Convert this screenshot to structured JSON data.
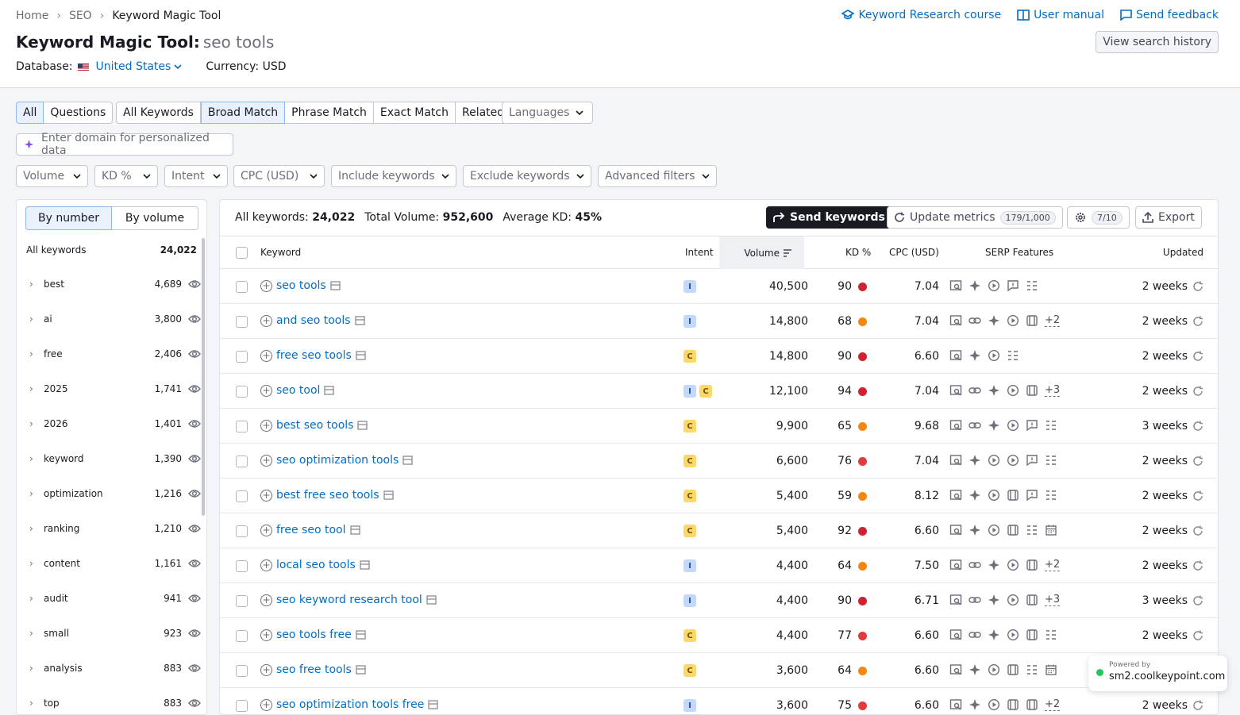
{
  "breadcrumb": [
    "Home",
    "SEO",
    "Keyword Magic Tool"
  ],
  "top_links": {
    "course": "Keyword Research course",
    "manual": "User manual",
    "feedback": "Send feedback"
  },
  "title": {
    "main": "Keyword Magic Tool:",
    "query": "seo tools"
  },
  "history_button": "View search history",
  "database": {
    "label": "Database:",
    "value": "United States",
    "currency": "Currency: USD"
  },
  "match_tabs": {
    "scope": [
      "All",
      "Questions"
    ],
    "types": [
      "All Keywords",
      "Broad Match",
      "Phrase Match",
      "Exact Match",
      "Related"
    ],
    "languages": "Languages"
  },
  "domain_placeholder": "Enter domain for personalized data",
  "filters": [
    "Volume",
    "KD %",
    "Intent",
    "CPC (USD)",
    "Include keywords",
    "Exclude keywords",
    "Advanced filters"
  ],
  "groups": {
    "toggle": [
      "By number",
      "By volume"
    ],
    "all_label": "All keywords",
    "all_count": "24,022",
    "items": [
      {
        "name": "best",
        "count": "4,689"
      },
      {
        "name": "ai",
        "count": "3,800"
      },
      {
        "name": "free",
        "count": "2,406"
      },
      {
        "name": "2025",
        "count": "1,741"
      },
      {
        "name": "2026",
        "count": "1,401"
      },
      {
        "name": "keyword",
        "count": "1,390"
      },
      {
        "name": "optimization",
        "count": "1,216"
      },
      {
        "name": "ranking",
        "count": "1,210"
      },
      {
        "name": "content",
        "count": "1,161"
      },
      {
        "name": "audit",
        "count": "941"
      },
      {
        "name": "small",
        "count": "923"
      },
      {
        "name": "analysis",
        "count": "883"
      },
      {
        "name": "top",
        "count": "883"
      }
    ]
  },
  "summary": {
    "all_label": "All keywords:",
    "all_value": "24,022",
    "vol_label": "Total Volume:",
    "vol_value": "952,600",
    "kd_label": "Average KD:",
    "kd_value": "45%"
  },
  "actions": {
    "send": "Send keywords",
    "update": "Update metrics",
    "update_pill": "179/1,000",
    "settings_pill": "7/10",
    "export": "Export"
  },
  "columns": {
    "keyword": "Keyword",
    "intent": "Intent",
    "volume": "Volume",
    "kd": "KD %",
    "cpc": "CPC (USD)",
    "serp": "SERP Features",
    "updated": "Updated"
  },
  "colors": {
    "kd_red": "#d1202f",
    "kd_orange": "#f6870a",
    "kd_light_red": "#e5393d",
    "link": "#006dca"
  },
  "rows": [
    {
      "kw": "seo tools",
      "intent": [
        "I"
      ],
      "vol": "40,500",
      "kd": "90",
      "kdc": "#d1202f",
      "cpc": "7.04",
      "serp": [
        "zoom",
        "sparkle",
        "play",
        "chat",
        "list"
      ],
      "more": "",
      "upd": "2 weeks"
    },
    {
      "kw": "and seo tools",
      "intent": [
        "I"
      ],
      "vol": "14,800",
      "kd": "68",
      "kdc": "#f6870a",
      "cpc": "7.04",
      "serp": [
        "zoom",
        "link",
        "sparkle",
        "play",
        "film"
      ],
      "more": "+2",
      "upd": "2 weeks"
    },
    {
      "kw": "free seo tools",
      "intent": [
        "C"
      ],
      "vol": "14,800",
      "kd": "90",
      "kdc": "#d1202f",
      "cpc": "6.60",
      "serp": [
        "zoom",
        "sparkle",
        "play",
        "list"
      ],
      "more": "",
      "upd": "2 weeks"
    },
    {
      "kw": "seo tool",
      "intent": [
        "I",
        "C"
      ],
      "vol": "12,100",
      "kd": "94",
      "kdc": "#d1202f",
      "cpc": "7.04",
      "serp": [
        "zoom",
        "link",
        "sparkle",
        "play",
        "film"
      ],
      "more": "+3",
      "upd": "2 weeks"
    },
    {
      "kw": "best seo tools",
      "intent": [
        "C"
      ],
      "vol": "9,900",
      "kd": "65",
      "kdc": "#f6870a",
      "cpc": "9.68",
      "serp": [
        "zoom",
        "link",
        "sparkle",
        "play",
        "chat",
        "list"
      ],
      "more": "",
      "upd": "3 weeks"
    },
    {
      "kw": "seo optimization tools",
      "intent": [
        "C"
      ],
      "vol": "6,600",
      "kd": "76",
      "kdc": "#e5393d",
      "cpc": "7.04",
      "serp": [
        "zoom",
        "sparkle",
        "play",
        "play",
        "chat",
        "list"
      ],
      "more": "",
      "upd": "2 weeks"
    },
    {
      "kw": "best free seo tools",
      "intent": [
        "C"
      ],
      "vol": "5,400",
      "kd": "59",
      "kdc": "#f6870a",
      "cpc": "8.12",
      "serp": [
        "zoom",
        "sparkle",
        "play",
        "film",
        "chat",
        "list"
      ],
      "more": "",
      "upd": "2 weeks"
    },
    {
      "kw": "free seo tool",
      "intent": [
        "C"
      ],
      "vol": "5,400",
      "kd": "92",
      "kdc": "#d1202f",
      "cpc": "6.60",
      "serp": [
        "zoom",
        "sparkle",
        "play",
        "film",
        "list",
        "cal"
      ],
      "more": "",
      "upd": "2 weeks"
    },
    {
      "kw": "local seo tools",
      "intent": [
        "I"
      ],
      "vol": "4,400",
      "kd": "64",
      "kdc": "#f6870a",
      "cpc": "7.50",
      "serp": [
        "zoom",
        "link",
        "sparkle",
        "play",
        "film"
      ],
      "more": "+2",
      "upd": "2 weeks"
    },
    {
      "kw": "seo keyword research tool",
      "intent": [
        "I"
      ],
      "vol": "4,400",
      "kd": "90",
      "kdc": "#d1202f",
      "cpc": "6.71",
      "serp": [
        "zoom",
        "link",
        "sparkle",
        "play",
        "film"
      ],
      "more": "+3",
      "upd": "3 weeks"
    },
    {
      "kw": "seo tools free",
      "intent": [
        "C"
      ],
      "vol": "4,400",
      "kd": "77",
      "kdc": "#e5393d",
      "cpc": "6.60",
      "serp": [
        "zoom",
        "link",
        "sparkle",
        "play",
        "film",
        "list"
      ],
      "more": "",
      "upd": "2 weeks"
    },
    {
      "kw": "seo free tools",
      "intent": [
        "C"
      ],
      "vol": "3,600",
      "kd": "64",
      "kdc": "#f6870a",
      "cpc": "6.60",
      "serp": [
        "zoom",
        "sparkle",
        "play",
        "film",
        "list",
        "cal"
      ],
      "more": "",
      "upd": "2 weeks"
    },
    {
      "kw": "seo optimization tools free",
      "intent": [
        "I"
      ],
      "vol": "3,600",
      "kd": "75",
      "kdc": "#e5393d",
      "cpc": "6.60",
      "serp": [
        "zoom",
        "sparkle",
        "play",
        "film",
        "film"
      ],
      "more": "+2",
      "upd": "2 weeks"
    }
  ],
  "powered": {
    "small": "Powered by",
    "domain": "sm2.coolkeypoint.com"
  }
}
